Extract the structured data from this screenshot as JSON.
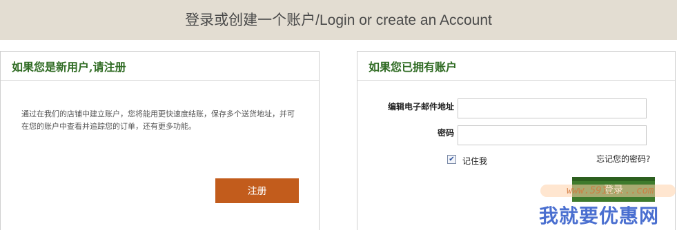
{
  "header": {
    "title": "登录或创建一个账户/Login or create an Account"
  },
  "new_customer": {
    "title": "如果您是新用户,请注册",
    "intro": "通过在我们的店铺中建立账户，您将能用更快速度结账，保存多个送货地址，并可在您的账户中查看并追踪您的订单，还有更多功能。",
    "register_label": "注册"
  },
  "login": {
    "title": "如果您已拥有账户",
    "email_label": "编辑电子邮件地址",
    "email_value": "",
    "password_label": "密码",
    "password_value": "",
    "remember_label": "记住我",
    "remember_checked": true,
    "forgot_label": "忘记您的密码?",
    "submit_label": "登录"
  },
  "watermark": {
    "url": "www.591.....com",
    "text": "我就要优惠网"
  },
  "colors": {
    "header_bg": "#e3ddd2",
    "title_green": "#2f6b23",
    "register_orange": "#c25c1c",
    "login_green": "#3e7a2c",
    "watermark_blue": "#4a6fd0"
  }
}
